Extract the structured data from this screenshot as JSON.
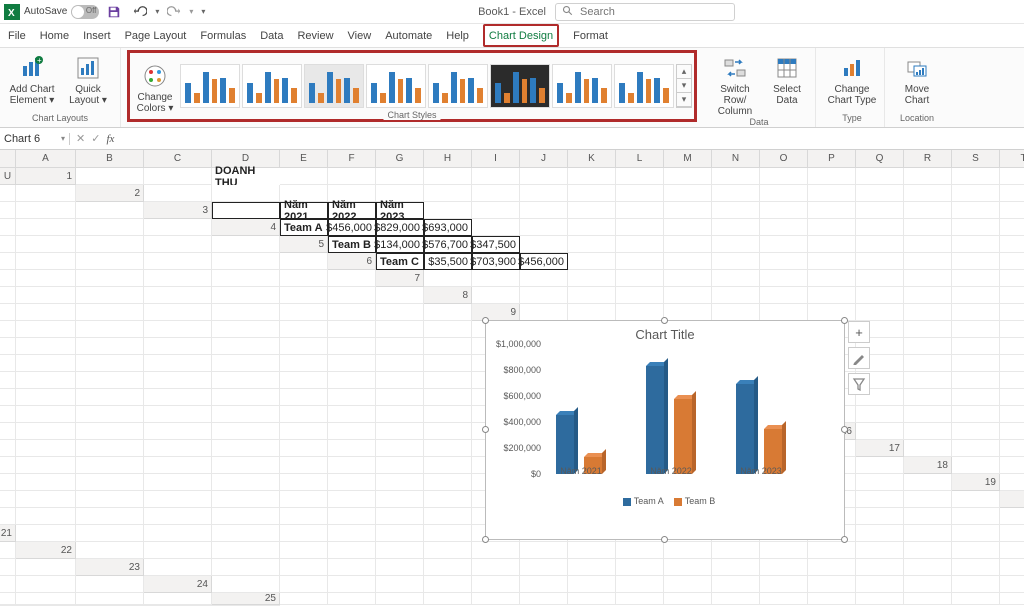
{
  "titlebar": {
    "autosave_label": "AutoSave",
    "autosave_state": "Off",
    "doc_title": "Book1 - Excel",
    "search_placeholder": "Search"
  },
  "tabs": {
    "file": "File",
    "home": "Home",
    "insert": "Insert",
    "page_layout": "Page Layout",
    "formulas": "Formulas",
    "data": "Data",
    "review": "Review",
    "view": "View",
    "automate": "Automate",
    "help": "Help",
    "chart_design": "Chart Design",
    "format": "Format"
  },
  "ribbon": {
    "chart_layouts": {
      "add_element": "Add Chart\nElement ▾",
      "quick_layout": "Quick\nLayout ▾",
      "group_label": "Chart Layouts"
    },
    "colors": {
      "change_colors": "Change\nColors ▾"
    },
    "styles_label": "Chart Styles",
    "data_group": {
      "switch": "Switch Row/\nColumn",
      "select": "Select\nData",
      "label": "Data"
    },
    "type_group": {
      "change_type": "Change\nChart Type",
      "label": "Type"
    },
    "location_group": {
      "move": "Move\nChart",
      "label": "Location"
    }
  },
  "namebox": "Chart 6",
  "formula": "",
  "columns": [
    "A",
    "B",
    "C",
    "D",
    "E",
    "F",
    "G",
    "H",
    "I",
    "J",
    "K",
    "L",
    "M",
    "N",
    "O",
    "P",
    "Q",
    "R",
    "S",
    "T",
    "U"
  ],
  "sheet": {
    "title_cell": "DOANH THU",
    "headers": [
      "Năm 2021",
      "Năm 2022",
      "Năm 2023"
    ],
    "rows": [
      {
        "label": "Team A",
        "values": [
          "$456,000",
          "$829,000",
          "$693,000"
        ]
      },
      {
        "label": "Team B",
        "values": [
          "$134,000",
          "$576,700",
          "$347,500"
        ]
      },
      {
        "label": "Team C",
        "values": [
          "$35,500",
          "$703,900",
          "$456,000"
        ]
      }
    ]
  },
  "chart": {
    "title": "Chart Title",
    "y_ticks": [
      "$0",
      "$200,000",
      "$400,000",
      "$600,000",
      "$800,000",
      "$1,000,000"
    ],
    "categories": [
      "Năm 2021",
      "Năm 2022",
      "Năm 2023"
    ],
    "legend": [
      "Team A",
      "Team B"
    ],
    "side_buttons": {
      "plus": "+",
      "brush": "brush",
      "filter": "filter"
    }
  },
  "chart_data": {
    "type": "bar",
    "title": "Chart Title",
    "categories": [
      "Năm 2021",
      "Năm 2022",
      "Năm 2023"
    ],
    "series": [
      {
        "name": "Team A",
        "values": [
          456000,
          829000,
          693000
        ]
      },
      {
        "name": "Team B",
        "values": [
          134000,
          576700,
          347500
        ]
      }
    ],
    "ylim": [
      0,
      1000000
    ],
    "ylabel": "",
    "xlabel": ""
  }
}
